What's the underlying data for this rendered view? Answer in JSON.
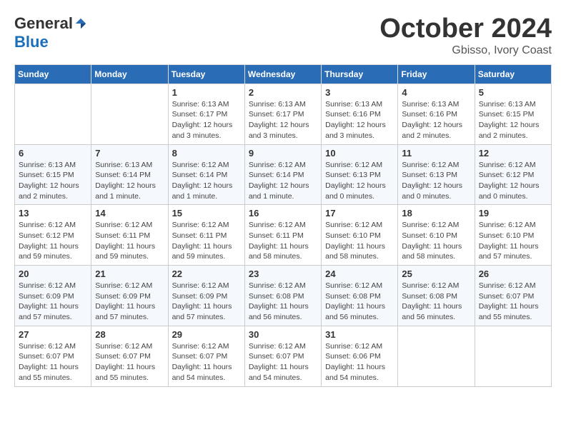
{
  "logo": {
    "general": "General",
    "blue": "Blue"
  },
  "title": {
    "month": "October 2024",
    "location": "Gbisso, Ivory Coast"
  },
  "weekdays": [
    "Sunday",
    "Monday",
    "Tuesday",
    "Wednesday",
    "Thursday",
    "Friday",
    "Saturday"
  ],
  "weeks": [
    [
      {
        "day": "",
        "detail": ""
      },
      {
        "day": "",
        "detail": ""
      },
      {
        "day": "1",
        "detail": "Sunrise: 6:13 AM\nSunset: 6:17 PM\nDaylight: 12 hours and 3 minutes."
      },
      {
        "day": "2",
        "detail": "Sunrise: 6:13 AM\nSunset: 6:17 PM\nDaylight: 12 hours and 3 minutes."
      },
      {
        "day": "3",
        "detail": "Sunrise: 6:13 AM\nSunset: 6:16 PM\nDaylight: 12 hours and 3 minutes."
      },
      {
        "day": "4",
        "detail": "Sunrise: 6:13 AM\nSunset: 6:16 PM\nDaylight: 12 hours and 2 minutes."
      },
      {
        "day": "5",
        "detail": "Sunrise: 6:13 AM\nSunset: 6:15 PM\nDaylight: 12 hours and 2 minutes."
      }
    ],
    [
      {
        "day": "6",
        "detail": "Sunrise: 6:13 AM\nSunset: 6:15 PM\nDaylight: 12 hours and 2 minutes."
      },
      {
        "day": "7",
        "detail": "Sunrise: 6:13 AM\nSunset: 6:14 PM\nDaylight: 12 hours and 1 minute."
      },
      {
        "day": "8",
        "detail": "Sunrise: 6:12 AM\nSunset: 6:14 PM\nDaylight: 12 hours and 1 minute."
      },
      {
        "day": "9",
        "detail": "Sunrise: 6:12 AM\nSunset: 6:14 PM\nDaylight: 12 hours and 1 minute."
      },
      {
        "day": "10",
        "detail": "Sunrise: 6:12 AM\nSunset: 6:13 PM\nDaylight: 12 hours and 0 minutes."
      },
      {
        "day": "11",
        "detail": "Sunrise: 6:12 AM\nSunset: 6:13 PM\nDaylight: 12 hours and 0 minutes."
      },
      {
        "day": "12",
        "detail": "Sunrise: 6:12 AM\nSunset: 6:12 PM\nDaylight: 12 hours and 0 minutes."
      }
    ],
    [
      {
        "day": "13",
        "detail": "Sunrise: 6:12 AM\nSunset: 6:12 PM\nDaylight: 11 hours and 59 minutes."
      },
      {
        "day": "14",
        "detail": "Sunrise: 6:12 AM\nSunset: 6:11 PM\nDaylight: 11 hours and 59 minutes."
      },
      {
        "day": "15",
        "detail": "Sunrise: 6:12 AM\nSunset: 6:11 PM\nDaylight: 11 hours and 59 minutes."
      },
      {
        "day": "16",
        "detail": "Sunrise: 6:12 AM\nSunset: 6:11 PM\nDaylight: 11 hours and 58 minutes."
      },
      {
        "day": "17",
        "detail": "Sunrise: 6:12 AM\nSunset: 6:10 PM\nDaylight: 11 hours and 58 minutes."
      },
      {
        "day": "18",
        "detail": "Sunrise: 6:12 AM\nSunset: 6:10 PM\nDaylight: 11 hours and 58 minutes."
      },
      {
        "day": "19",
        "detail": "Sunrise: 6:12 AM\nSunset: 6:10 PM\nDaylight: 11 hours and 57 minutes."
      }
    ],
    [
      {
        "day": "20",
        "detail": "Sunrise: 6:12 AM\nSunset: 6:09 PM\nDaylight: 11 hours and 57 minutes."
      },
      {
        "day": "21",
        "detail": "Sunrise: 6:12 AM\nSunset: 6:09 PM\nDaylight: 11 hours and 57 minutes."
      },
      {
        "day": "22",
        "detail": "Sunrise: 6:12 AM\nSunset: 6:09 PM\nDaylight: 11 hours and 57 minutes."
      },
      {
        "day": "23",
        "detail": "Sunrise: 6:12 AM\nSunset: 6:08 PM\nDaylight: 11 hours and 56 minutes."
      },
      {
        "day": "24",
        "detail": "Sunrise: 6:12 AM\nSunset: 6:08 PM\nDaylight: 11 hours and 56 minutes."
      },
      {
        "day": "25",
        "detail": "Sunrise: 6:12 AM\nSunset: 6:08 PM\nDaylight: 11 hours and 56 minutes."
      },
      {
        "day": "26",
        "detail": "Sunrise: 6:12 AM\nSunset: 6:07 PM\nDaylight: 11 hours and 55 minutes."
      }
    ],
    [
      {
        "day": "27",
        "detail": "Sunrise: 6:12 AM\nSunset: 6:07 PM\nDaylight: 11 hours and 55 minutes."
      },
      {
        "day": "28",
        "detail": "Sunrise: 6:12 AM\nSunset: 6:07 PM\nDaylight: 11 hours and 55 minutes."
      },
      {
        "day": "29",
        "detail": "Sunrise: 6:12 AM\nSunset: 6:07 PM\nDaylight: 11 hours and 54 minutes."
      },
      {
        "day": "30",
        "detail": "Sunrise: 6:12 AM\nSunset: 6:07 PM\nDaylight: 11 hours and 54 minutes."
      },
      {
        "day": "31",
        "detail": "Sunrise: 6:12 AM\nSunset: 6:06 PM\nDaylight: 11 hours and 54 minutes."
      },
      {
        "day": "",
        "detail": ""
      },
      {
        "day": "",
        "detail": ""
      }
    ]
  ]
}
